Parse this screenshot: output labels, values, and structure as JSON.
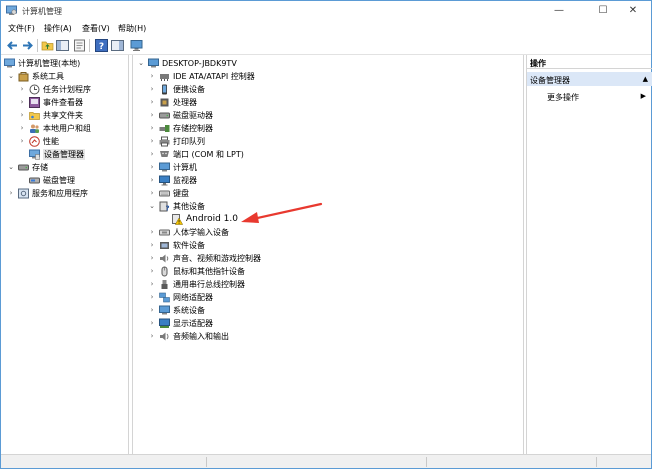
{
  "window": {
    "title": "计算机管理",
    "minimize_glyph": "—",
    "maximize_glyph": "☐",
    "close_glyph": "✕"
  },
  "menu": [
    "文件(F)",
    "操作(A)",
    "查看(V)",
    "帮助(H)"
  ],
  "toolbar": {
    "icons": [
      "back-arrow-icon",
      "forward-arrow-icon",
      "folder-up-icon",
      "show-hide-tree-icon",
      "properties-icon",
      "help-icon",
      "action-pane-icon",
      "monitor-icon"
    ]
  },
  "left_tree": {
    "root": "计算机管理(本地)",
    "items": [
      {
        "label": "系统工具",
        "level": 1,
        "expanded": true
      },
      {
        "label": "任务计划程序",
        "level": 2
      },
      {
        "label": "事件查看器",
        "level": 2
      },
      {
        "label": "共享文件夹",
        "level": 2
      },
      {
        "label": "本地用户和组",
        "level": 2
      },
      {
        "label": "性能",
        "level": 2
      },
      {
        "label": "设备管理器",
        "level": 2,
        "selected": true
      },
      {
        "label": "存储",
        "level": 1,
        "expanded": true
      },
      {
        "label": "磁盘管理",
        "level": 2
      },
      {
        "label": "服务和应用程序",
        "level": 1
      }
    ]
  },
  "device_tree": {
    "root": "DESKTOP-JBDK9TV",
    "items": [
      {
        "label": "IDE ATA/ATAPI 控制器",
        "icon": "ide-controller-icon"
      },
      {
        "label": "便携设备",
        "icon": "portable-device-icon"
      },
      {
        "label": "处理器",
        "icon": "processor-icon"
      },
      {
        "label": "磁盘驱动器",
        "icon": "disk-drive-icon"
      },
      {
        "label": "存储控制器",
        "icon": "storage-controller-icon"
      },
      {
        "label": "打印队列",
        "icon": "printer-icon"
      },
      {
        "label": "端口 (COM 和 LPT)",
        "icon": "port-icon"
      },
      {
        "label": "计算机",
        "icon": "computer-icon"
      },
      {
        "label": "监视器",
        "icon": "monitor-icon"
      },
      {
        "label": "键盘",
        "icon": "keyboard-icon"
      },
      {
        "label": "其他设备",
        "icon": "other-device-icon",
        "expanded": true
      },
      {
        "label": "Android 1.0",
        "icon": "warning-device-icon",
        "child": true
      },
      {
        "label": "人体学输入设备",
        "icon": "hid-icon"
      },
      {
        "label": "软件设备",
        "icon": "software-device-icon"
      },
      {
        "label": "声音、视频和游戏控制器",
        "icon": "sound-icon"
      },
      {
        "label": "鼠标和其他指针设备",
        "icon": "mouse-icon"
      },
      {
        "label": "通用串行总线控制器",
        "icon": "usb-icon"
      },
      {
        "label": "网络适配器",
        "icon": "network-icon"
      },
      {
        "label": "系统设备",
        "icon": "system-device-icon"
      },
      {
        "label": "显示适配器",
        "icon": "display-adapter-icon"
      },
      {
        "label": "音频输入和输出",
        "icon": "audio-io-icon"
      }
    ]
  },
  "actions": {
    "header": "操作",
    "section": "设备管理器",
    "more": "更多操作"
  },
  "colors": {
    "accent": "#5b9bd5",
    "selection": "#e5e5e5",
    "action_section": "#dbe7f7",
    "annotation_arrow": "#e8392f"
  }
}
